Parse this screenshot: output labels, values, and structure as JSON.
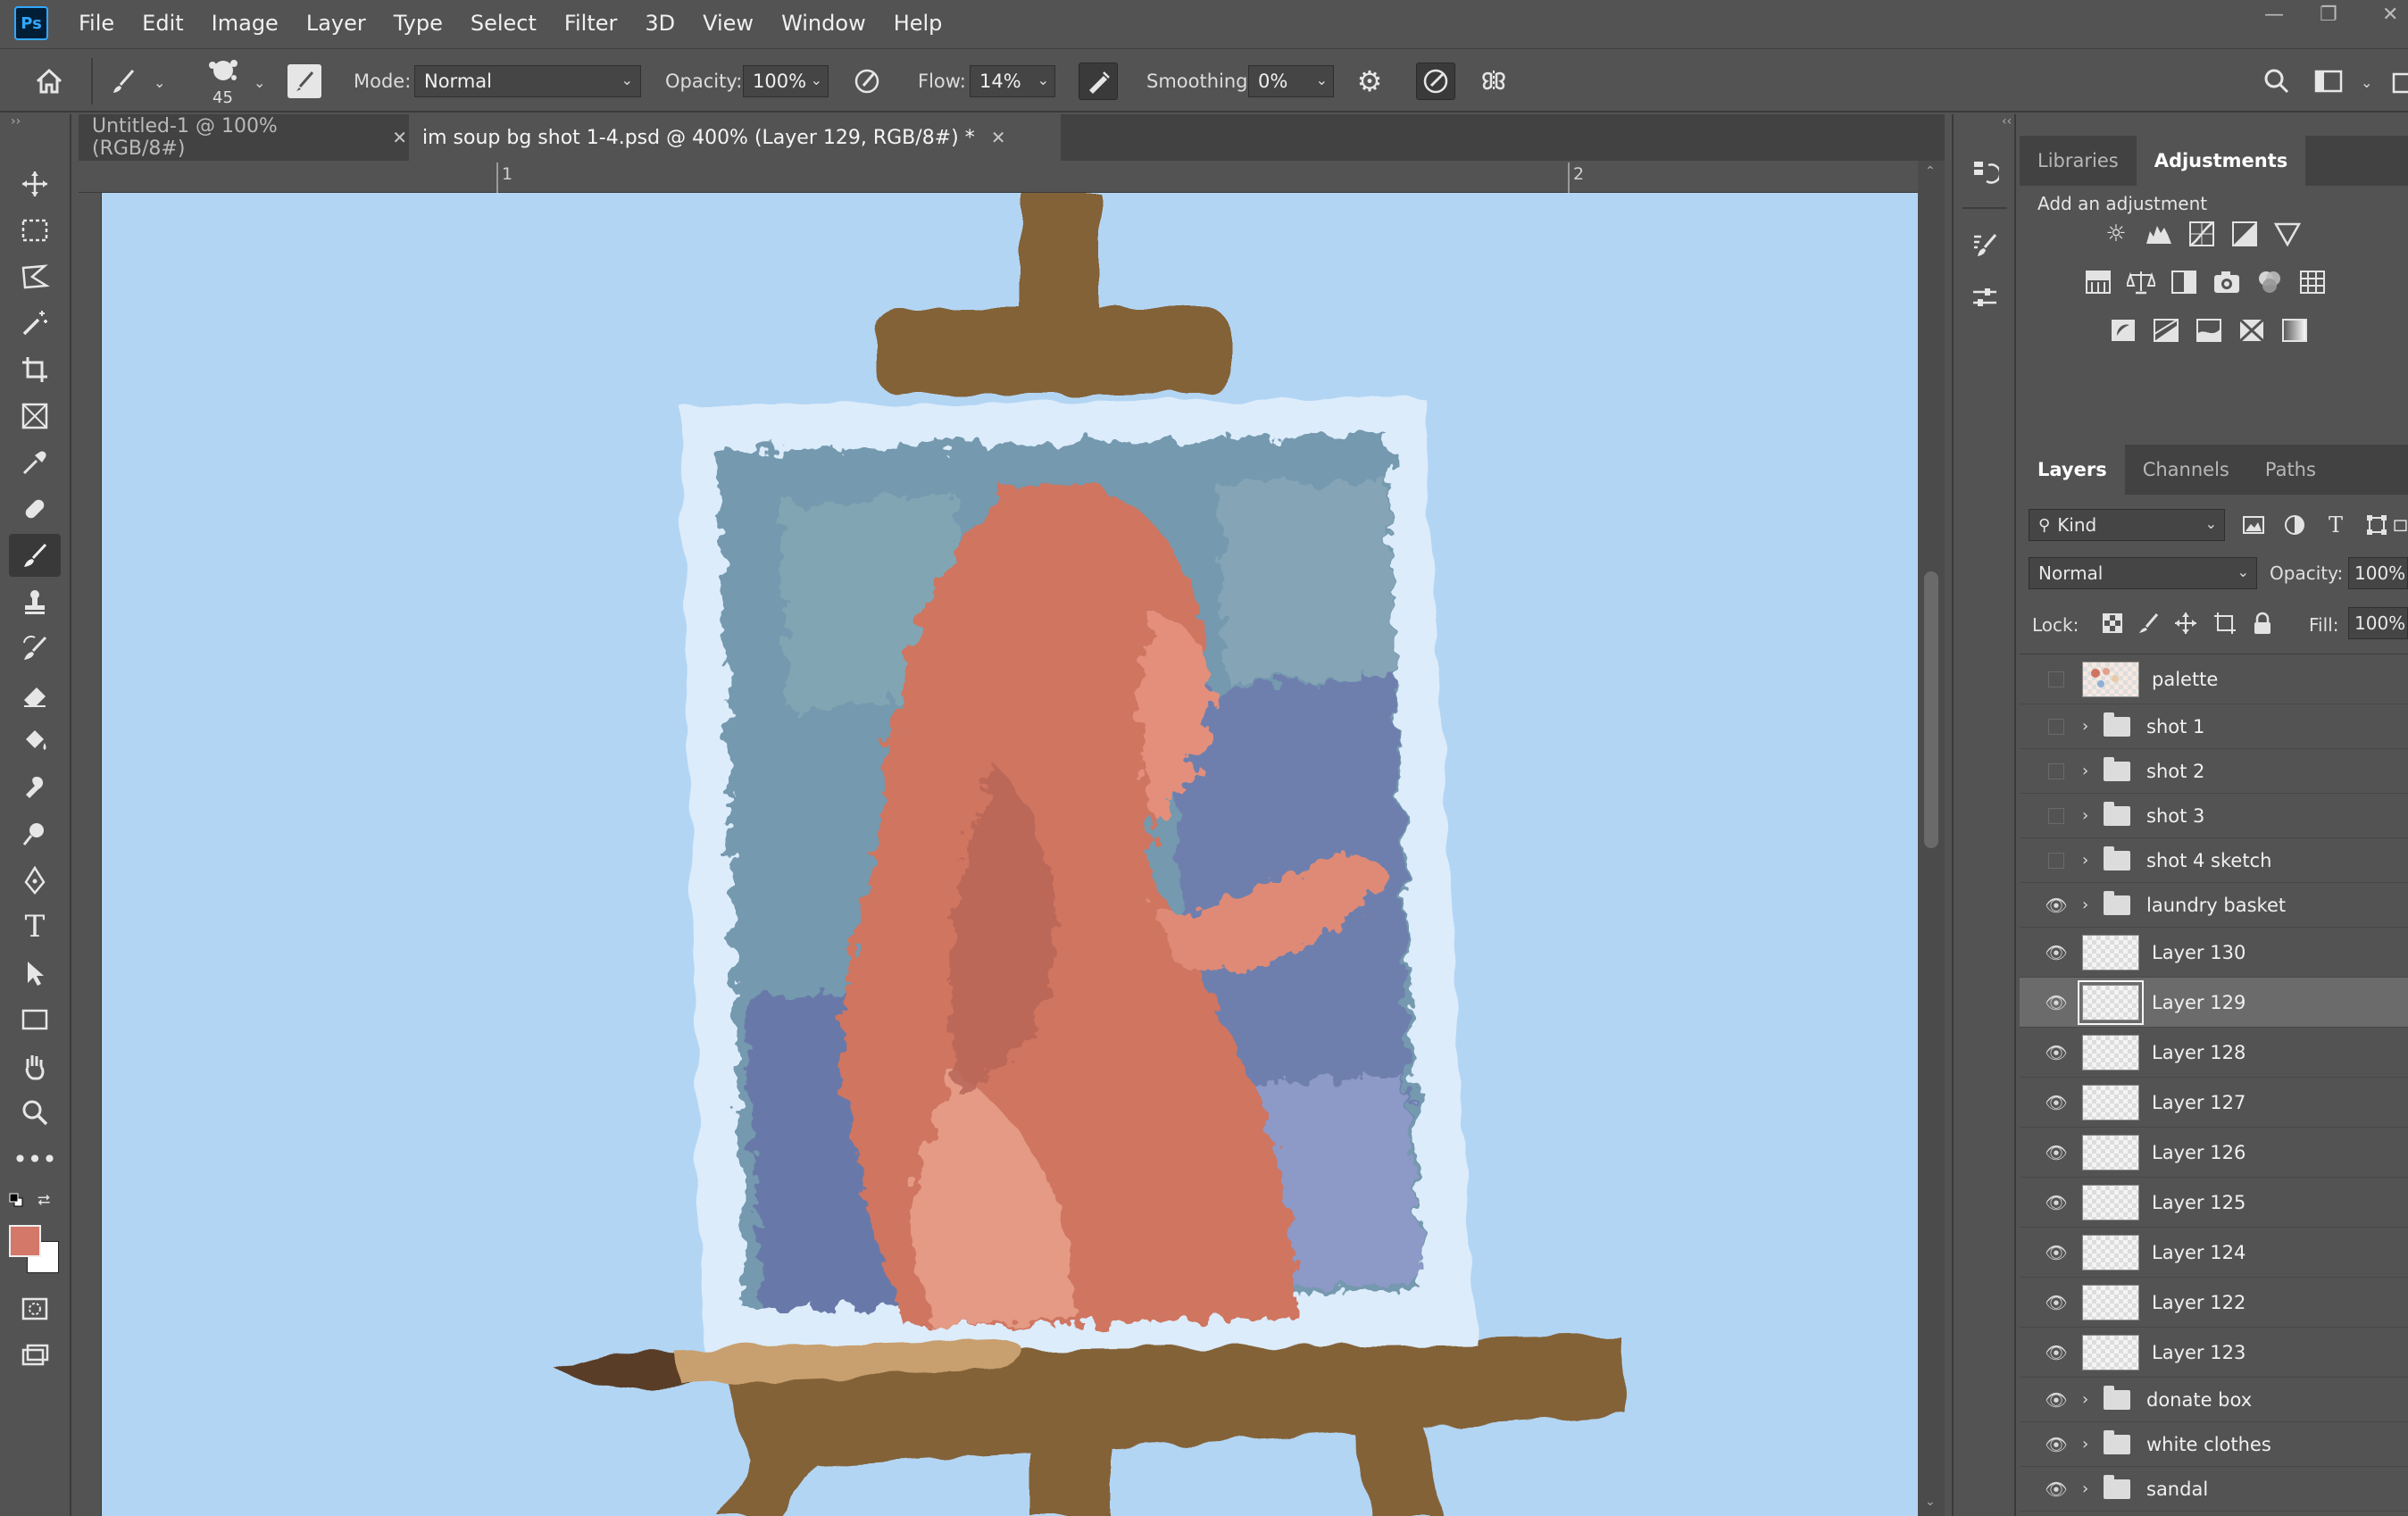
{
  "app": {
    "logo": "Ps"
  },
  "menu": [
    "File",
    "Edit",
    "Image",
    "Layer",
    "Type",
    "Select",
    "Filter",
    "3D",
    "View",
    "Window",
    "Help"
  ],
  "options": {
    "brush_size": "45",
    "mode_label": "Mode:",
    "mode_value": "Normal",
    "opacity_label": "Opacity:",
    "opacity_value": "100%",
    "flow_label": "Flow:",
    "flow_value": "14%",
    "smoothing_label": "Smoothing:",
    "smoothing_value": "0%"
  },
  "tabs": [
    {
      "title": "Untitled-1 @ 100% (RGB/8#)",
      "active": false
    },
    {
      "title": "im soup bg shot 1-4.psd @ 400% (Layer 129, RGB/8#) *",
      "active": true
    }
  ],
  "rulers": {
    "h_labels": [
      "1",
      "2"
    ]
  },
  "colors": {
    "foreground": "#d4786a",
    "background": "#ffffff",
    "canvas_bg": "#b3d5f4"
  },
  "adjustments": {
    "tabs": [
      "Libraries",
      "Adjustments"
    ],
    "active_tab": "Adjustments",
    "heading": "Add an adjustment",
    "icons": [
      [
        "brightness-contrast-icon",
        "levels-icon",
        "curves-icon",
        "exposure-icon",
        "vibrance-icon"
      ],
      [
        "hue-saturation-icon",
        "color-balance-icon",
        "black-white-icon",
        "photo-filter-icon",
        "channel-mixer-icon",
        "color-lookup-icon"
      ],
      [
        "invert-icon",
        "posterize-icon",
        "threshold-icon",
        "selective-color-icon",
        "gradient-map-icon"
      ]
    ]
  },
  "layers": {
    "tabs": [
      "Layers",
      "Channels",
      "Paths"
    ],
    "active_tab": "Layers",
    "filter_kind": "Kind",
    "blend_mode": "Normal",
    "opacity_label": "Opacity:",
    "opacity_value": "100%",
    "lock_label": "Lock:",
    "fill_label": "Fill:",
    "fill_value": "100%",
    "items": [
      {
        "name": "palette",
        "type": "layer",
        "visible": false
      },
      {
        "name": "shot 1",
        "type": "group",
        "visible": false
      },
      {
        "name": "shot 2",
        "type": "group",
        "visible": false
      },
      {
        "name": "shot 3",
        "type": "group",
        "visible": false
      },
      {
        "name": "shot 4 sketch",
        "type": "group",
        "visible": false
      },
      {
        "name": "laundry basket",
        "type": "group",
        "visible": true
      },
      {
        "name": "Layer 130",
        "type": "layer",
        "visible": true
      },
      {
        "name": "Layer 129",
        "type": "layer",
        "visible": true,
        "selected": true
      },
      {
        "name": "Layer 128",
        "type": "layer",
        "visible": true
      },
      {
        "name": "Layer 127",
        "type": "layer",
        "visible": true
      },
      {
        "name": "Layer 126",
        "type": "layer",
        "visible": true
      },
      {
        "name": "Layer 125",
        "type": "layer",
        "visible": true
      },
      {
        "name": "Layer 124",
        "type": "layer",
        "visible": true
      },
      {
        "name": "Layer 122",
        "type": "layer",
        "visible": true
      },
      {
        "name": "Layer 123",
        "type": "layer",
        "visible": true
      },
      {
        "name": "donate box",
        "type": "group",
        "visible": true
      },
      {
        "name": "white clothes",
        "type": "group",
        "visible": true
      },
      {
        "name": "sandal",
        "type": "group",
        "visible": true
      }
    ]
  }
}
